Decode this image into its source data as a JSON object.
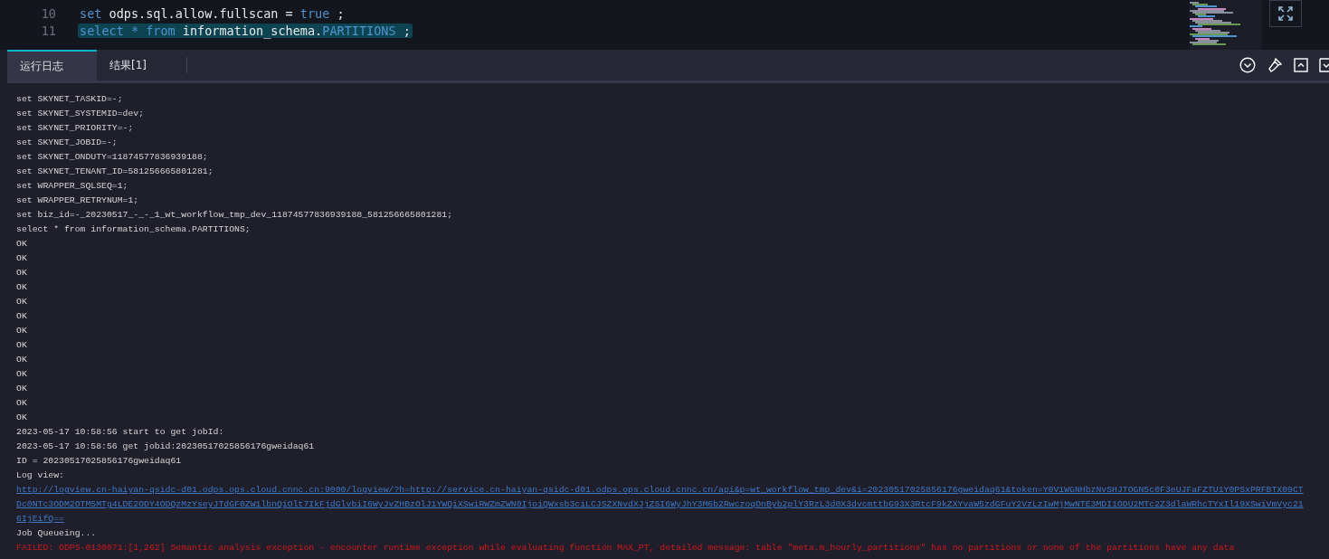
{
  "editor": {
    "lines": [
      {
        "number": "10",
        "selected": false,
        "tokens": [
          {
            "text": "set",
            "kind": "keyword"
          },
          {
            "text": " odps.sql.allow.fullscan = ",
            "kind": "plain"
          },
          {
            "text": "true",
            "kind": "keyword"
          },
          {
            "text": " ;",
            "kind": "plain"
          }
        ]
      },
      {
        "number": "11",
        "selected": true,
        "tokens": [
          {
            "text": "select",
            "kind": "keyword"
          },
          {
            "text": " * ",
            "kind": "keyword"
          },
          {
            "text": "from",
            "kind": "keyword"
          },
          {
            "text": " information_schema.",
            "kind": "plain"
          },
          {
            "text": "PARTITIONS",
            "kind": "keyword"
          },
          {
            "text": " ;",
            "kind": "plain"
          }
        ]
      }
    ]
  },
  "tabs": [
    {
      "label": "运行日志",
      "selected": true
    },
    {
      "label": "结果[1]",
      "selected": false
    }
  ],
  "log": [
    {
      "kind": "plain",
      "text": "set SKYNET_TASKID=-;"
    },
    {
      "kind": "plain",
      "text": "set SKYNET_SYSTEMID=dev;"
    },
    {
      "kind": "plain",
      "text": "set SKYNET_PRIORITY=-;"
    },
    {
      "kind": "plain",
      "text": "set SKYNET_JOBID=-;"
    },
    {
      "kind": "plain",
      "text": "set SKYNET_ONDUTY=11874577836939188;"
    },
    {
      "kind": "plain",
      "text": "set SKYNET_TENANT_ID=581256665801281;"
    },
    {
      "kind": "plain",
      "text": "set WRAPPER_SQLSEQ=1;"
    },
    {
      "kind": "plain",
      "text": "set WRAPPER_RETRYNUM=1;"
    },
    {
      "kind": "plain",
      "text": "set biz_id=-_20230517_-_-_1_wt_workflow_tmp_dev_11874577836939188_581256665801281;"
    },
    {
      "kind": "plain",
      "text": "select * from information_schema.PARTITIONS;"
    },
    {
      "kind": "plain",
      "text": "OK"
    },
    {
      "kind": "plain",
      "text": "OK"
    },
    {
      "kind": "plain",
      "text": "OK"
    },
    {
      "kind": "plain",
      "text": "OK"
    },
    {
      "kind": "plain",
      "text": "OK"
    },
    {
      "kind": "plain",
      "text": "OK"
    },
    {
      "kind": "plain",
      "text": "OK"
    },
    {
      "kind": "plain",
      "text": "OK"
    },
    {
      "kind": "plain",
      "text": "OK"
    },
    {
      "kind": "plain",
      "text": "OK"
    },
    {
      "kind": "plain",
      "text": "OK"
    },
    {
      "kind": "plain",
      "text": "OK"
    },
    {
      "kind": "plain",
      "text": "OK"
    },
    {
      "kind": "plain",
      "text": "2023-05-17 10:58:56 start to get jobId:"
    },
    {
      "kind": "plain",
      "text": "2023-05-17 10:58:56 get jobid:20230517025856176gweidaq61"
    },
    {
      "kind": "plain",
      "text": "ID = 20230517025856176gweidaq61"
    },
    {
      "kind": "plain",
      "text": "Log view:"
    },
    {
      "kind": "link",
      "text": "http://logview.cn-haiyan-qsidc-d01.odps.ops.cloud.cnnc.cn:9000/logview/?h=http://service.cn-haiyan-qsidc-d01.odps.ops.cloud.cnnc.cn/api&p=wt_workflow_tmp_dev&i=20230517025856176gweidaq61&token=Y0V1WGNHbzNvSHJTOGN5c0F3eUJFaFZTU1Y0PSxPRFBTX09CT"
    },
    {
      "kind": "link",
      "text": "Dc0NTc3ODM2OTM5MTg4LDE2ODY4ODQzMzYseyJTdGF0ZW1lbnQiOlt7IkFjdGlvbiI6WyJvZHBzOlJ1YWQiXSwiRWZmZWN0IjoiQWxsb3ciLCJSZXNvdXJjZSI6WyJhY3M6b2RwczoqOnByb2plY3RzL3d0X3dvcmttbG93X3RtcF9kZXYvaW5zdGFuY2VzLzIwMjMwNTE3MDI1ODU2MTc2Z3dlaWRhcTYxIl19XSwiVmVyc21"
    },
    {
      "kind": "link",
      "text": "6IjEifQ=="
    },
    {
      "kind": "plain",
      "text": "Job Queueing..."
    },
    {
      "kind": "error",
      "text": "FAILED: ODPS-0130071:[1,262] Semantic analysis exception - encounter runtime exception while evaluating function MAX_PT, detailed message: table \"meta.m_hourly_partitions\" has no partitions or none of the partitions have any data"
    }
  ]
}
